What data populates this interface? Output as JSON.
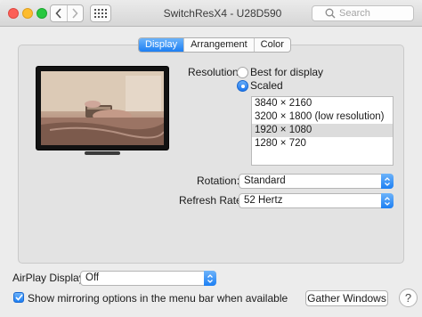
{
  "window": {
    "title": "SwitchResX4 - U28D590"
  },
  "toolbar": {
    "grid_icon": "grid-icon",
    "back_icon": "chevron-left-icon",
    "forward_icon": "chevron-right-icon"
  },
  "search": {
    "placeholder": "Search"
  },
  "tabs": [
    {
      "label": "Display",
      "active": true
    },
    {
      "label": "Arrangement",
      "active": false
    },
    {
      "label": "Color",
      "active": false
    }
  ],
  "resolution": {
    "label": "Resolution:",
    "options": [
      {
        "label": "Best for display",
        "selected": false
      },
      {
        "label": "Scaled",
        "selected": true
      }
    ],
    "list": [
      "3840 × 2160",
      "3200 × 1800 (low resolution)",
      "1920 × 1080",
      "1280 × 720"
    ],
    "selected_index": 2
  },
  "rotation": {
    "label": "Rotation:",
    "value": "Standard"
  },
  "refresh": {
    "label": "Refresh Rate:",
    "value": "52 Hertz"
  },
  "airplay": {
    "label": "AirPlay Display:",
    "value": "Off"
  },
  "mirroring": {
    "label": "Show mirroring options in the menu bar when available",
    "checked": true
  },
  "buttons": {
    "gather": "Gather Windows",
    "help": "?"
  },
  "colors": {
    "accent": "#1d7ff3",
    "close": "#fc5f57",
    "minimize": "#fdbc2e",
    "zoom": "#28c840"
  }
}
